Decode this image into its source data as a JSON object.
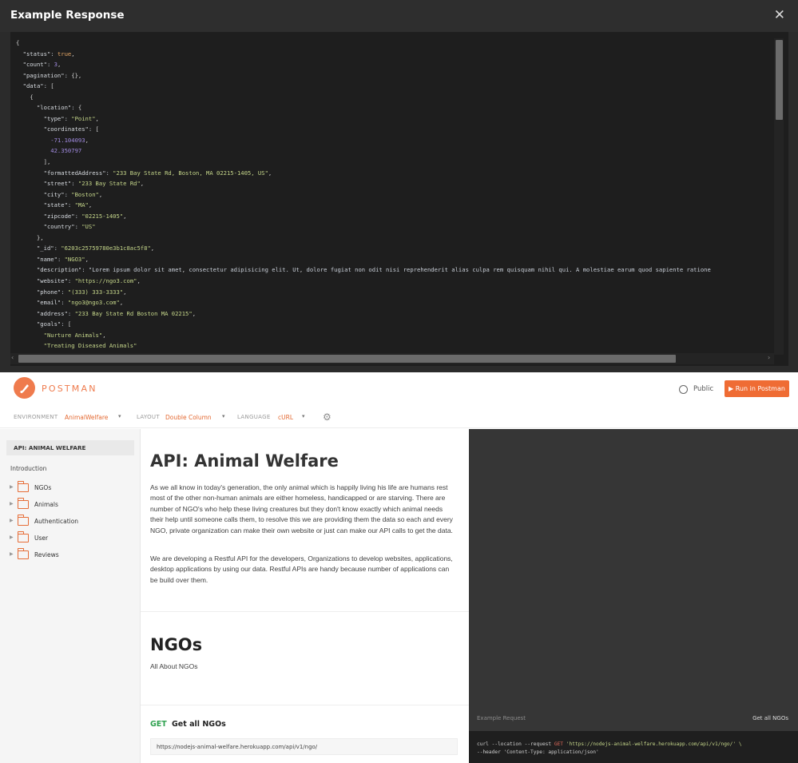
{
  "modal": {
    "title": "Example Response",
    "close_glyph": "✕",
    "json_lines": [
      "{",
      "  \"status\": true,",
      "  \"count\": 3,",
      "  \"pagination\": {},",
      "  \"data\": [",
      "    {",
      "      \"location\": {",
      "        \"type\": \"Point\",",
      "        \"coordinates\": [",
      "          -71.104093,",
      "          42.350797",
      "        ],",
      "        \"formattedAddress\": \"233 Bay State Rd, Boston, MA 02215-1405, US\",",
      "        \"street\": \"233 Bay State Rd\",",
      "        \"city\": \"Boston\",",
      "        \"state\": \"MA\",",
      "        \"zipcode\": \"02215-1405\",",
      "        \"country\": \"US\"",
      "      },",
      "      \"_id\": \"6203c25759780e3b1c8ac5f8\",",
      "      \"name\": \"NGO3\",",
      "      \"description\": \"Lorem ipsum dolor sit amet, consectetur adipisicing elit. Ut, dolore fugiat non odit nisi reprehenderit alias culpa rem quisquam nihil qui. A molestiae earum quod sapiente ratione",
      "      \"website\": \"https://ngo3.com\",",
      "      \"phone\": \"(333) 333-3333\",",
      "      \"email\": \"ngo3@ngo3.com\",",
      "      \"address\": \"233 Bay State Rd Boston MA 02215\",",
      "      \"goals\": [",
      "        \"Nurture Animals\",",
      "        \"Treating Diseased Animals\""
    ]
  },
  "topbar": {
    "logo_text": "POSTMAN",
    "public_label": "Public",
    "run_button_label": "▶ Run in Postman"
  },
  "envbar": {
    "environment_label": "ENVIRONMENT",
    "environment_value": "AnimalWelfare",
    "layout_label": "LAYOUT",
    "layout_value": "Double Column",
    "language_label": "LANGUAGE",
    "language_value": "cURL",
    "caret": "▾"
  },
  "sidebar": {
    "collection": "API: ANIMAL WELFARE",
    "introduction": "Introduction",
    "items": [
      {
        "label": "NGOs"
      },
      {
        "label": "Animals"
      },
      {
        "label": "Authentication"
      },
      {
        "label": "User"
      },
      {
        "label": "Reviews"
      }
    ]
  },
  "main": {
    "title": "API: Animal Welfare",
    "intro_p1": "As we all know in today's generation, the only animal which is happily living his life are humans rest most of the other non-human animals are either homeless, handicapped or are starving. There are number of NGO's who help these living creatures but they don't know exactly which animal needs their help until someone calls them, to resolve this we are providing them the data so each and every NGO, private organization can make their own website or just can make our API calls to get the data.",
    "intro_p2": "We are developing a Restful API for the developers, Organizations to develop websites, applications, desktop applications by using our data. Restful APIs are handy because number of applications can be build over them.",
    "section_title": "NGOs",
    "section_desc": "All About NGOs",
    "method": "GET",
    "endpoint_name": "Get all NGOs",
    "url": "https://nodejs-animal-welfare.herokuapp.com/api/v1/ngo/"
  },
  "dark_panel": {
    "example_request_label": "Example Request",
    "example_request_name": "Get all NGOs",
    "curl_prefix": "curl --location --request ",
    "curl_method": "GET",
    "curl_url": " 'https://nodejs-animal-welfare.herokuapp.com/api/v1/ngo/' \\",
    "curl_header": "--header 'Content-Type: application/json'"
  }
}
